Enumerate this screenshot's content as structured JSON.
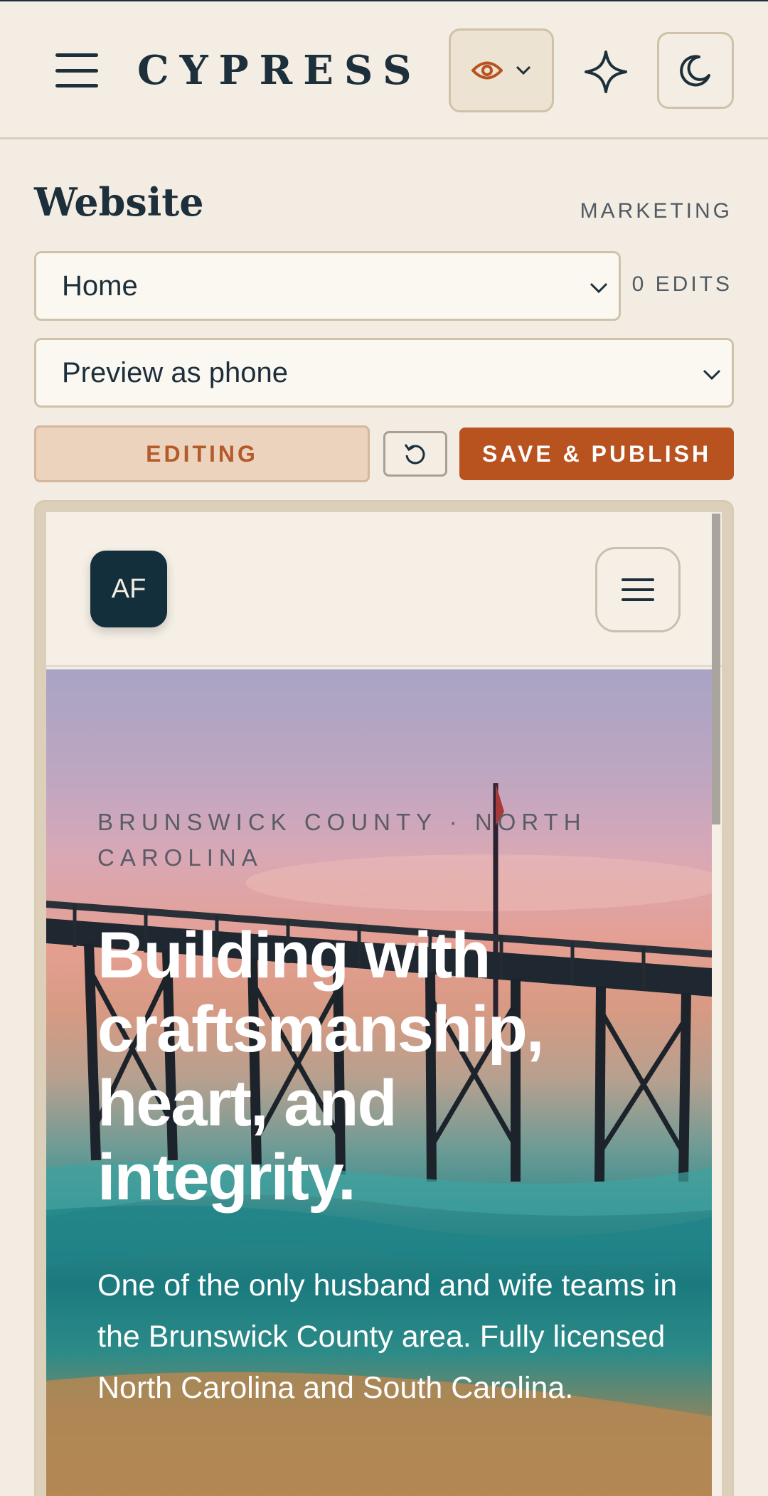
{
  "app": {
    "brand": "CYPRESS"
  },
  "editor": {
    "heading": "Website",
    "section_tag": "MARKETING",
    "page_select": {
      "value": "Home"
    },
    "edit_count": "0 EDITS",
    "preview_select": {
      "value": "Preview as phone"
    },
    "editing_label": "EDITING",
    "publish_label": "SAVE & PUBLISH"
  },
  "site": {
    "avatar_initials": "AF",
    "hero": {
      "eyebrow": "BRUNSWICK COUNTY · NORTH CAROLINA",
      "title": "Building with craftsmanship, heart, and integrity.",
      "body": "One of the only husband and wife teams in the Brunswick County area. Fully licensed North Carolina and South Carolina."
    }
  },
  "colors": {
    "primary": "#1c2f3a",
    "accent": "#b8521f",
    "background": "#f3ece2"
  },
  "icons": {
    "menu": "hamburger-icon",
    "preview": "eye-icon",
    "ai": "sparkle-icon",
    "theme": "moon-icon",
    "undo": "undo-icon"
  }
}
